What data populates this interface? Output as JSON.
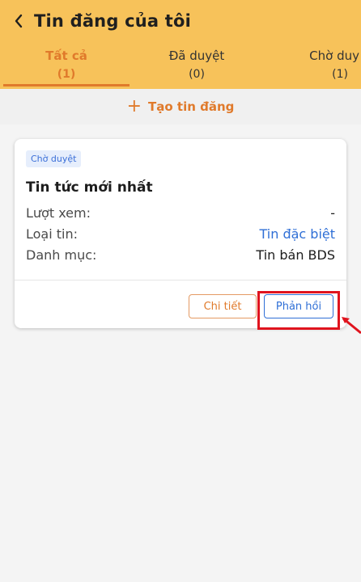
{
  "header": {
    "title": "Tin đăng của tôi",
    "back_icon": "chevron-left-icon"
  },
  "tabs": [
    {
      "label": "Tất cả",
      "count": "(1)",
      "active": true
    },
    {
      "label": "Đã duyệt",
      "count": "(0)",
      "active": false
    },
    {
      "label": "Chờ duy",
      "count": "(1)",
      "active": false
    }
  ],
  "create_bar": {
    "icon": "plus-icon",
    "label": "Tạo tin đăng"
  },
  "card": {
    "status_badge": "Chờ duyệt",
    "title": "Tin tức mới nhất",
    "rows": [
      {
        "label": "Lượt xem:",
        "value": "-"
      },
      {
        "label": "Loại tin:",
        "value": "Tin đặc biệt"
      },
      {
        "label": "Danh mục:",
        "value": "Tin bán BDS"
      }
    ],
    "detail_button": "Chi tiết",
    "feedback_button": "Phản hồi"
  },
  "colors": {
    "header_bg": "#f7c25a",
    "accent_orange": "#e07a2b",
    "link_blue": "#2f6fd6",
    "annotation_red": "#e0141e"
  }
}
